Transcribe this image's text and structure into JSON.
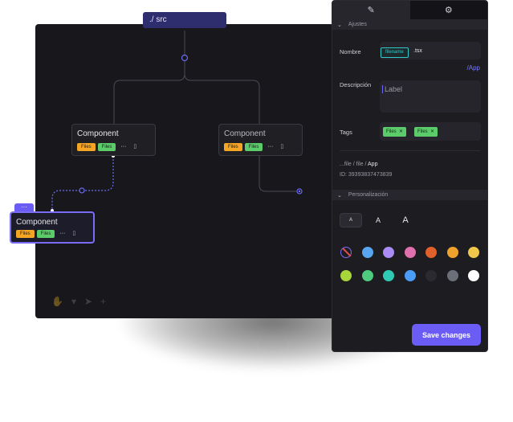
{
  "breadcrumb": {
    "src": "./ src"
  },
  "nodes": [
    {
      "title": "Component",
      "chips": [
        "Files",
        "Files"
      ]
    },
    {
      "title": "Component",
      "chips": [
        "Files",
        "Files"
      ]
    },
    {
      "title": "Component",
      "chips": [
        "Files",
        "Files"
      ]
    }
  ],
  "node_more": "···",
  "node_tab": "···",
  "panel": {
    "sections": {
      "ajustes": "Ajustes",
      "personalizacion": "Personalización"
    },
    "fields": {
      "nombre_label": "Nombre",
      "filename_chip": "filename",
      "extension": ".tsx",
      "app_link": "/App",
      "descripcion_label": "Descripción",
      "descripcion_placeholder": "Label",
      "tags_label": "Tags",
      "tags": [
        "Files",
        "Files"
      ]
    },
    "path": {
      "prefix": "...file / file / ",
      "current": "App"
    },
    "id_text": "ID: 39393837473839",
    "size_options": [
      "A",
      "A",
      "A"
    ],
    "colors": [
      "none",
      "#58a6f0",
      "#a98cf4",
      "#e06fae",
      "#e2602a",
      "#eea22c",
      "#f1c64a",
      "#a8d43c",
      "#4ecb7f",
      "#2fc9b5",
      "#4a9cf5",
      "#2a2a30",
      "#6b6f7a",
      "#ffffff"
    ],
    "save_label": "Save changes"
  },
  "colors": {
    "accent": "#6b5cf6",
    "orange_chip": "#f5a524",
    "green_chip": "#5ccc6b"
  }
}
